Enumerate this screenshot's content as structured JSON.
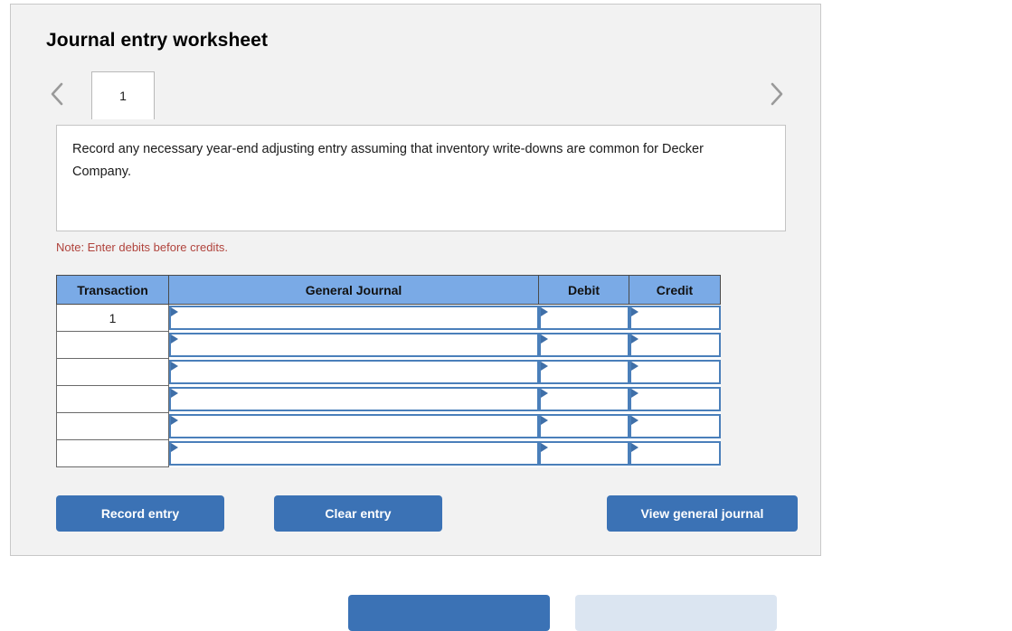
{
  "panel": {
    "title": "Journal entry worksheet"
  },
  "tabs": {
    "prev_icon": "chevron-left-icon",
    "next_icon": "chevron-right-icon",
    "items": [
      {
        "label": "1",
        "active": true
      }
    ]
  },
  "instruction": {
    "text": "Record any necessary year-end adjusting entry assuming that inventory write-downs are common for Decker Company."
  },
  "note": {
    "text": "Note: Enter debits before credits."
  },
  "table": {
    "headers": [
      "Transaction",
      "General Journal",
      "Debit",
      "Credit"
    ],
    "rows": [
      {
        "transaction": "1",
        "general_journal": "",
        "debit": "",
        "credit": ""
      },
      {
        "transaction": "",
        "general_journal": "",
        "debit": "",
        "credit": ""
      },
      {
        "transaction": "",
        "general_journal": "",
        "debit": "",
        "credit": ""
      },
      {
        "transaction": "",
        "general_journal": "",
        "debit": "",
        "credit": ""
      },
      {
        "transaction": "",
        "general_journal": "",
        "debit": "",
        "credit": ""
      },
      {
        "transaction": "",
        "general_journal": "",
        "debit": "",
        "credit": ""
      }
    ]
  },
  "actions": {
    "record_entry": "Record entry",
    "clear_entry": "Clear entry",
    "view_general_journal": "View general journal"
  },
  "footer": {
    "primary": "",
    "secondary": ""
  },
  "colors": {
    "header_blue": "#7aaae6",
    "button_blue": "#3b72b5",
    "input_border_blue": "#4a7fba",
    "note_red": "#b0433c",
    "panel_bg": "#f2f2f2"
  }
}
